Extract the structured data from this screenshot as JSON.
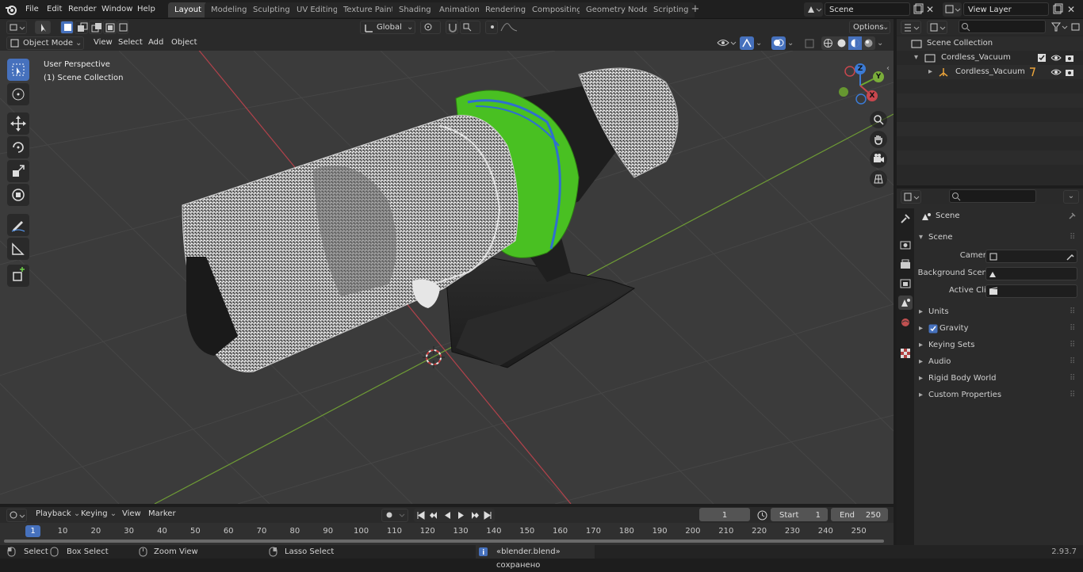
{
  "menubar": {
    "items": [
      "File",
      "Edit",
      "Render",
      "Window",
      "Help"
    ]
  },
  "workspaces": [
    "Layout",
    "Modeling",
    "Sculpting",
    "UV Editing",
    "Texture Paint",
    "Shading",
    "Animation",
    "Rendering",
    "Compositing",
    "Geometry Nodes",
    "Scripting"
  ],
  "active_workspace": "Layout",
  "scene_field": "Scene",
  "view_layer_field": "View Layer",
  "header": {
    "transform_orientation": "Global",
    "options_label": "Options",
    "mode": "Object Mode",
    "menus": [
      "View",
      "Select",
      "Add",
      "Object"
    ]
  },
  "viewport": {
    "perspective_label": "User Perspective",
    "collection_label": "(1) Scene Collection",
    "gizmo_axes": [
      "X",
      "Y",
      "Z"
    ]
  },
  "outliner": {
    "rows": [
      {
        "label": "Scene Collection"
      },
      {
        "label": "Cordless_Vacuum"
      },
      {
        "label": "Cordless_Vacuum"
      }
    ]
  },
  "properties": {
    "context_label": "Scene",
    "panel_title": "Scene",
    "fields": [
      {
        "label": "Camera"
      },
      {
        "label": "Background Scene"
      },
      {
        "label": "Active Clip"
      }
    ],
    "subpanels": [
      "Units",
      "Gravity",
      "Keying Sets",
      "Audio",
      "Rigid Body World",
      "Custom Properties"
    ],
    "gravity_checked": true
  },
  "timeline": {
    "menus": [
      "Playback",
      "Keying",
      "View",
      "Marker"
    ],
    "current_frame": "1",
    "start_label": "Start",
    "start_value": "1",
    "end_label": "End",
    "end_value": "250",
    "ticks": [
      "1",
      "10",
      "20",
      "30",
      "40",
      "50",
      "60",
      "70",
      "80",
      "90",
      "100",
      "110",
      "120",
      "130",
      "140",
      "150",
      "160",
      "170",
      "180",
      "190",
      "200",
      "210",
      "220",
      "230",
      "240",
      "250"
    ]
  },
  "statusbar": {
    "select": "Select",
    "box_select": "Box Select",
    "zoom_view": "Zoom View",
    "lasso_select": "Lasso Select",
    "message": "«blender.blend» сохранено",
    "version": "2.93.7"
  },
  "colors": {
    "accent": "#4671bd",
    "x_axis": "#c8474e",
    "y_axis": "#7aad3a",
    "z_axis": "#3b7bd6",
    "vacuum_green": "#49c022"
  }
}
